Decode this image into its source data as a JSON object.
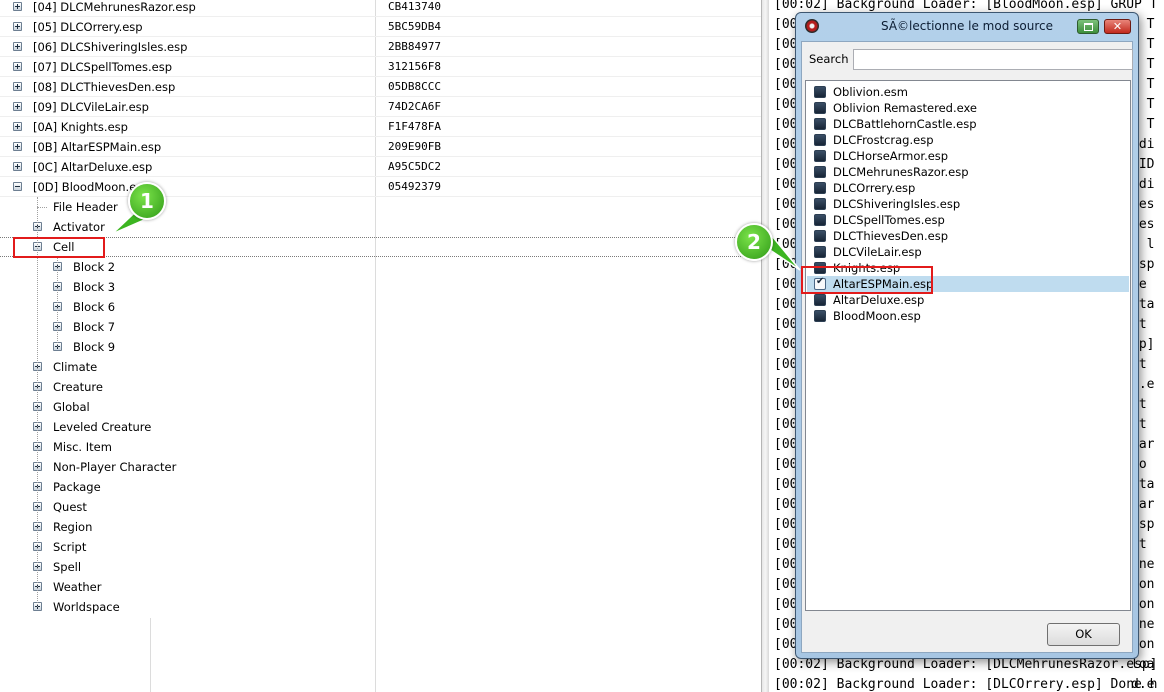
{
  "tree": {
    "rows": [
      {
        "label": "[04] DLCMehrunesRazor.esp",
        "code": "CB413740"
      },
      {
        "label": "[05] DLCOrrery.esp",
        "code": "5BC59DB4"
      },
      {
        "label": "[06] DLCShiveringIsles.esp",
        "code": "2BB84977"
      },
      {
        "label": "[07] DLCSpellTomes.esp",
        "code": "312156F8"
      },
      {
        "label": "[08] DLCThievesDen.esp",
        "code": "05DB8CCC"
      },
      {
        "label": "[09] DLCVileLair.esp",
        "code": "74D2CA6F"
      },
      {
        "label": "[0A] Knights.esp",
        "code": "F1F478FA"
      },
      {
        "label": "[0B] AltarESPMain.esp",
        "code": "209E90FB"
      },
      {
        "label": "[0C] AltarDeluxe.esp",
        "code": "A95C5DC2"
      },
      {
        "label": "[0D] BloodMoon.e",
        "code": "05492379"
      }
    ],
    "bloodmoon_children": {
      "file_header": "File Header",
      "activator": "Activator",
      "cell": "Cell",
      "cell_blocks": [
        "Block 2",
        "Block 3",
        "Block 6",
        "Block 7",
        "Block 9"
      ],
      "groups": [
        "Climate",
        "Creature",
        "Global",
        "Leveled Creature",
        "Misc. Item",
        "Non-Player Character",
        "Package",
        "Quest",
        "Region",
        "Script",
        "Spell",
        "Weather",
        "Worldspace"
      ]
    }
  },
  "log": {
    "lines": [
      "[00:02] Background Loader: [BloodMoon.esp] GRUP T",
      "[00",
      "[00",
      "[00",
      "[00",
      "[00",
      "[00",
      "[00",
      "[00",
      "[00",
      "[00",
      "[00",
      "[00",
      "[00",
      "[00",
      "[00",
      "[00",
      "[00",
      "[00",
      "[00",
      "[00",
      "[00",
      "[00",
      "[00",
      "[00",
      "[00",
      "[00",
      "[00",
      "[00",
      "[00",
      "[00",
      "[00",
      "[00",
      "[00:02] Background Loader: [DLCMehrunesRazor.esp]",
      "[00:02] Background Loader: [DLCOrrery.esp] Done h"
    ],
    "right_edge_fragments": [
      "P T",
      "P T",
      "P T",
      "P T",
      "P T",
      "P T",
      "ldi",
      "mID",
      "ldi",
      "ces",
      "ces",
      "t l",
      "esp",
      ".e",
      "Sta",
      "St",
      "sp]",
      "rt",
      "l.e",
      "St",
      "St",
      "tar",
      "lo",
      "Sta",
      "tar",
      "esp",
      "rt",
      "one",
      "Don",
      "Don",
      "one",
      "Don",
      "loa",
      "d.e",
      "Don"
    ]
  },
  "dialog": {
    "title": "SÃ©lectionne le mod source",
    "close_glyph": "✕",
    "search_label": "Search",
    "search_value": "",
    "mods": [
      {
        "name": "Oblivion.esm",
        "checked": false
      },
      {
        "name": "Oblivion Remastered.exe",
        "checked": false
      },
      {
        "name": "DLCBattlehornCastle.esp",
        "checked": false
      },
      {
        "name": "DLCFrostcrag.esp",
        "checked": false
      },
      {
        "name": "DLCHorseArmor.esp",
        "checked": false
      },
      {
        "name": "DLCMehrunesRazor.esp",
        "checked": false
      },
      {
        "name": "DLCOrrery.esp",
        "checked": false
      },
      {
        "name": "DLCShiveringIsles.esp",
        "checked": false
      },
      {
        "name": "DLCSpellTomes.esp",
        "checked": false
      },
      {
        "name": "DLCThievesDen.esp",
        "checked": false
      },
      {
        "name": "DLCVileLair.esp",
        "checked": false
      },
      {
        "name": "Knights.esp",
        "checked": false
      },
      {
        "name": "AltarESPMain.esp",
        "checked": true
      },
      {
        "name": "AltarDeluxe.esp",
        "checked": false
      },
      {
        "name": "BloodMoon.esp",
        "checked": false
      }
    ],
    "ok_label": "OK"
  },
  "markers": {
    "step1": "1",
    "step2": "2",
    "color": "#3cb521",
    "highlight_color": "#e21b1b"
  }
}
